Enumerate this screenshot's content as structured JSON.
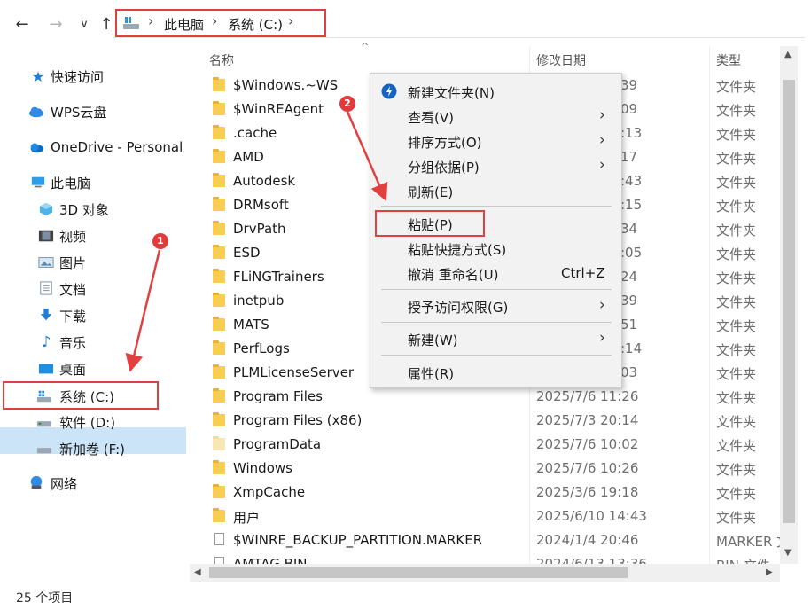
{
  "nav": {
    "back": "←",
    "forward": "→",
    "recent": "∨",
    "up": "↑",
    "breadcrumb": [
      "此电脑",
      "系统 (C:)"
    ],
    "sep": "›"
  },
  "sidebar": {
    "items": [
      {
        "label": "快速访问",
        "icon": "star-icon"
      },
      {
        "label": "WPS云盘",
        "icon": "cloud-icon"
      },
      {
        "label": "OneDrive - Personal",
        "icon": "onedrive-icon"
      },
      {
        "label": "此电脑",
        "icon": "computer-icon"
      },
      {
        "label": "3D 对象",
        "icon": "cube-3d-icon"
      },
      {
        "label": "视频",
        "icon": "video-icon"
      },
      {
        "label": "图片",
        "icon": "picture-icon"
      },
      {
        "label": "文档",
        "icon": "document-icon"
      },
      {
        "label": "下载",
        "icon": "download-icon"
      },
      {
        "label": "音乐",
        "icon": "music-icon"
      },
      {
        "label": "桌面",
        "icon": "desktop-icon"
      },
      {
        "label": "系统 (C:)",
        "icon": "drive-c-icon",
        "selected": true
      },
      {
        "label": "软件 (D:)",
        "icon": "drive-icon"
      },
      {
        "label": "新加卷 (F:)",
        "icon": "drive-icon"
      },
      {
        "label": "网络",
        "icon": "network-icon"
      }
    ]
  },
  "columns": {
    "name": "名称",
    "date": "修改日期",
    "type": "类型",
    "sort_indicator": "^"
  },
  "files": [
    {
      "name": "$Windows.~WS",
      "date": "",
      "date_tail": "39",
      "type": "文件夹",
      "kind": "folder"
    },
    {
      "name": "$WinREAgent",
      "date": "",
      "date_tail": "09",
      "type": "文件夹",
      "kind": "folder"
    },
    {
      "name": ".cache",
      "date": "",
      "date_tail": ":13",
      "type": "文件夹",
      "kind": "folder"
    },
    {
      "name": "AMD",
      "date": "",
      "date_tail": "17",
      "type": "文件夹",
      "kind": "folder"
    },
    {
      "name": "Autodesk",
      "date": "",
      "date_tail": ":43",
      "type": "文件夹",
      "kind": "folder"
    },
    {
      "name": "DRMsoft",
      "date": "",
      "date_tail": ":15",
      "type": "文件夹",
      "kind": "folder"
    },
    {
      "name": "DrvPath",
      "date": "",
      "date_tail": "34",
      "type": "文件夹",
      "kind": "folder"
    },
    {
      "name": "ESD",
      "date": "",
      "date_tail": ":05",
      "type": "文件夹",
      "kind": "folder"
    },
    {
      "name": "FLiNGTrainers",
      "date": "",
      "date_tail": "24",
      "type": "文件夹",
      "kind": "folder"
    },
    {
      "name": "inetpub",
      "date": "",
      "date_tail": "39",
      "type": "文件夹",
      "kind": "folder"
    },
    {
      "name": "MATS",
      "date": "",
      "date_tail": "51",
      "type": "文件夹",
      "kind": "folder"
    },
    {
      "name": "PerfLogs",
      "date": "",
      "date_tail": ":14",
      "type": "文件夹",
      "kind": "folder"
    },
    {
      "name": "PLMLicenseServer",
      "date": "",
      "date_tail": "03",
      "type": "文件夹",
      "kind": "folder"
    },
    {
      "name": "Program Files",
      "date": "2025/7/6 11:26",
      "date_tail": "",
      "type": "文件夹",
      "kind": "folder"
    },
    {
      "name": "Program Files (x86)",
      "date": "2025/7/3 20:14",
      "date_tail": "",
      "type": "文件夹",
      "kind": "folder"
    },
    {
      "name": "ProgramData",
      "date": "2025/7/6 10:02",
      "date_tail": "",
      "type": "文件夹",
      "kind": "folder-pale"
    },
    {
      "name": "Windows",
      "date": "2025/7/6 10:26",
      "date_tail": "",
      "type": "文件夹",
      "kind": "folder"
    },
    {
      "name": "XmpCache",
      "date": "2025/3/6 19:18",
      "date_tail": "",
      "type": "文件夹",
      "kind": "folder"
    },
    {
      "name": "用户",
      "date": "2025/6/10 14:43",
      "date_tail": "",
      "type": "文件夹",
      "kind": "folder"
    },
    {
      "name": "$WINRE_BACKUP_PARTITION.MARKER",
      "date": "2024/1/4 20:46",
      "date_tail": "",
      "type": "MARKER 文",
      "kind": "file"
    },
    {
      "name": "AMTAG.BIN",
      "date": "2024/6/13 13:36",
      "date_tail": "",
      "type": "BIN 文件",
      "kind": "file"
    }
  ],
  "context_menu": {
    "items": [
      {
        "label": "新建文件夹(N)",
        "icon": "new-folder-badge-icon"
      },
      {
        "label": "查看(V)",
        "submenu": true
      },
      {
        "label": "排序方式(O)",
        "submenu": true
      },
      {
        "label": "分组依据(P)",
        "submenu": true
      },
      {
        "label": "刷新(E)"
      },
      {
        "label": "粘贴(P)",
        "highlighted": true
      },
      {
        "label": "粘贴快捷方式(S)"
      },
      {
        "label": "撤消 重命名(U)",
        "shortcut": "Ctrl+Z"
      },
      {
        "label": "授予访问权限(G)",
        "submenu": true
      },
      {
        "label": "新建(W)",
        "submenu": true
      },
      {
        "label": "属性(R)"
      }
    ],
    "submenu_arrow": "›"
  },
  "annotations": {
    "badge1": "1",
    "badge2": "2",
    "accent": "#e04040"
  },
  "status": {
    "count": "25 个项目"
  }
}
